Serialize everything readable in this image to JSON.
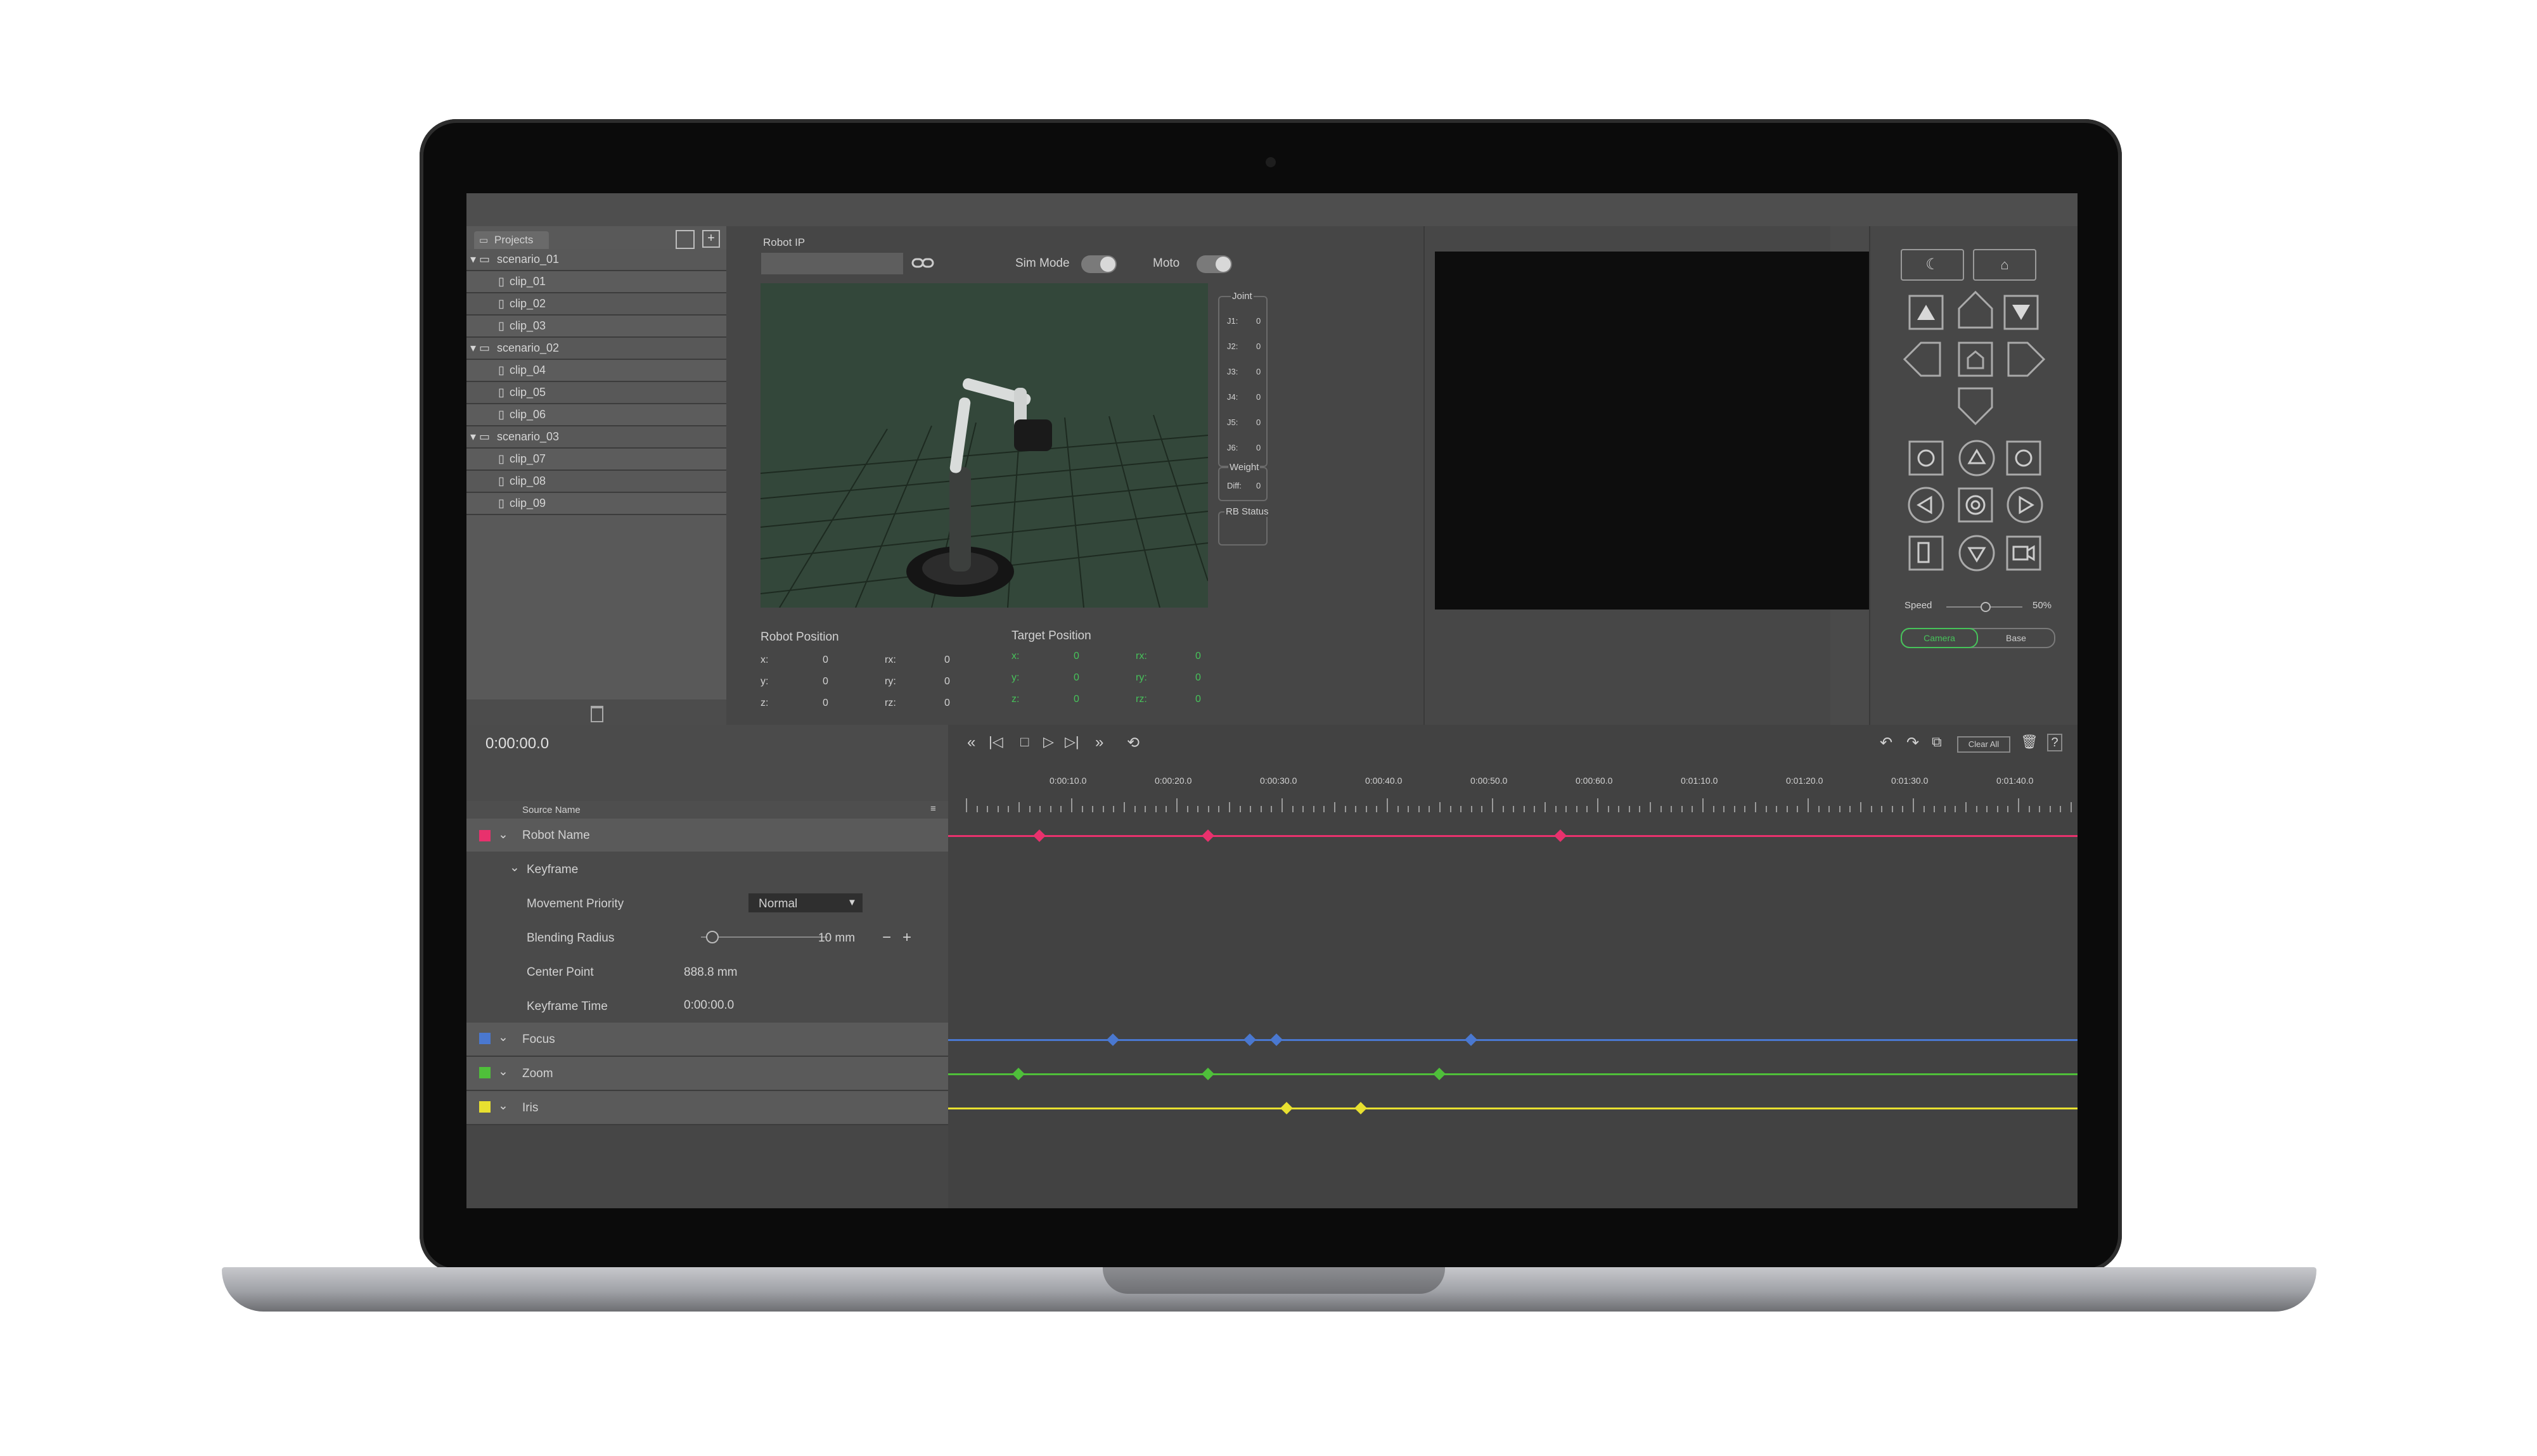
{
  "projects": {
    "tab_label": "Projects",
    "tree": [
      {
        "label": "scenario_01",
        "type": "folder"
      },
      {
        "label": "clip_01",
        "type": "clip"
      },
      {
        "label": "clip_02",
        "type": "clip"
      },
      {
        "label": "clip_03",
        "type": "clip"
      },
      {
        "label": "scenario_02",
        "type": "folder"
      },
      {
        "label": "clip_04",
        "type": "clip"
      },
      {
        "label": "clip_05",
        "type": "clip"
      },
      {
        "label": "clip_06",
        "type": "clip"
      },
      {
        "label": "scenario_03",
        "type": "folder"
      },
      {
        "label": "clip_07",
        "type": "clip"
      },
      {
        "label": "clip_08",
        "type": "clip"
      },
      {
        "label": "clip_09",
        "type": "clip"
      }
    ]
  },
  "robot": {
    "ip_label": "Robot IP",
    "ip_value": "",
    "sim_mode_label": "Sim Mode",
    "moto_label": "Moto",
    "joint_title": "Joint",
    "joints": [
      {
        "name": "J1:",
        "value": "0"
      },
      {
        "name": "J2:",
        "value": "0"
      },
      {
        "name": "J3:",
        "value": "0"
      },
      {
        "name": "J4:",
        "value": "0"
      },
      {
        "name": "J5:",
        "value": "0"
      },
      {
        "name": "J6:",
        "value": "0"
      }
    ],
    "weight_title": "Weight",
    "diff_label": "Diff:",
    "diff_value": "0",
    "rb_status_label": "RB Status",
    "position_title": "Robot Position",
    "position": [
      {
        "axis": "x:",
        "value": "0",
        "raxis": "rx:",
        "rvalue": "0"
      },
      {
        "axis": "y:",
        "value": "0",
        "raxis": "ry:",
        "rvalue": "0"
      },
      {
        "axis": "z:",
        "value": "0",
        "raxis": "rz:",
        "rvalue": "0"
      }
    ],
    "target_title": "Target Position",
    "target": [
      {
        "axis": "x:",
        "value": "0",
        "raxis": "rx:",
        "rvalue": "0"
      },
      {
        "axis": "y:",
        "value": "0",
        "raxis": "ry:",
        "rvalue": "0"
      },
      {
        "axis": "z:",
        "value": "0",
        "raxis": "rz:",
        "rvalue": "0"
      }
    ]
  },
  "controls": {
    "speed_label": "Speed",
    "speed_value": "50%",
    "speed_fraction": 0.5,
    "mode_tabs": [
      "Camera",
      "Base"
    ],
    "active_mode": "Camera"
  },
  "timeline": {
    "timecode": "0:00:00.0",
    "source_header": "Source Name",
    "clear_all_label": "Clear All",
    "time_labels": [
      "0:00:10.0",
      "0:00:20.0",
      "0:00:30.0",
      "0:00:40.0",
      "0:00:50.0",
      "0:00:60.0",
      "0:01:10.0",
      "0:01:20.0",
      "0:01:30.0",
      "0:01:40.0"
    ],
    "tracks": [
      {
        "name": "Robot Name",
        "color": "#e8316d",
        "keyframes_sec": [
          7,
          23,
          56.5
        ]
      },
      {
        "name": "Focus",
        "color": "#4a78d0",
        "keyframes_sec": [
          14,
          27,
          29.5,
          48
        ]
      },
      {
        "name": "Zoom",
        "color": "#4fbf3a",
        "keyframes_sec": [
          5,
          23,
          45
        ]
      },
      {
        "name": "Iris",
        "color": "#e8e030",
        "keyframes_sec": [
          30.5,
          37.5
        ]
      }
    ],
    "keyframe_group_label": "Keyframe",
    "properties": {
      "movement_priority_label": "Movement Priority",
      "movement_priority_value": "Normal",
      "blending_radius_label": "Blending Radius",
      "blending_radius_value": "10 mm",
      "center_point_label": "Center Point",
      "center_point_value": "888.8 mm",
      "keyframe_time_label": "Keyframe Time",
      "keyframe_time_value": "0:00:00.0"
    }
  }
}
